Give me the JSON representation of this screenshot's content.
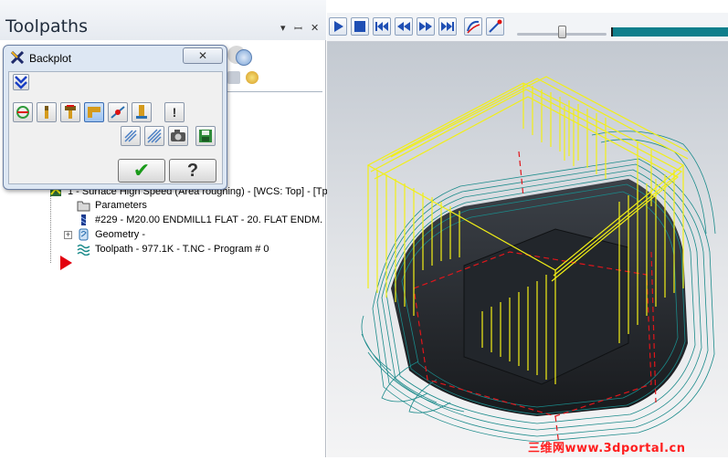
{
  "panel": {
    "title": "Toolpaths",
    "pin_glyph": "▾",
    "autohide_glyph": "📌",
    "close_glyph": "✕"
  },
  "backplot": {
    "title": "Backplot",
    "close_glyph": "✕",
    "ok_glyph": "✔",
    "help_glyph": "?",
    "info_glyph": "!",
    "icons": [
      "expand-arrows-icon",
      "rotate-icon",
      "tool-icon",
      "holder-icon",
      "tool-holder-active-icon",
      "path-points-icon",
      "shank-icon",
      "info-icon",
      "hatch-single-icon",
      "hatch-double-icon",
      "camera-icon",
      "save-icon"
    ]
  },
  "tree": {
    "operation": "1 - Surface High Speed (Area roughing) - [WCS: Top] - [Tp",
    "parameters": "Parameters",
    "tool": "#229 - M20.00 ENDMILL1 FLAT -     20. FLAT ENDM.",
    "geometry": "Geometry -",
    "toolpath": "Toolpath - 977.1K - T.NC - Program # 0"
  },
  "playback": {
    "icons": [
      "play-icon",
      "stop-icon",
      "skip-back-icon",
      "step-back-icon",
      "step-forward-icon",
      "skip-forward-icon",
      "path-trace-icon",
      "path-options-icon"
    ],
    "speed_fraction": 0.5
  },
  "colors": {
    "accent": "#0f7f8c",
    "rapid": "#f2ef16",
    "toolpath": "#1a8a8a",
    "boundary": "#e0161b"
  },
  "watermark": "三维网www.3dportal.cn"
}
